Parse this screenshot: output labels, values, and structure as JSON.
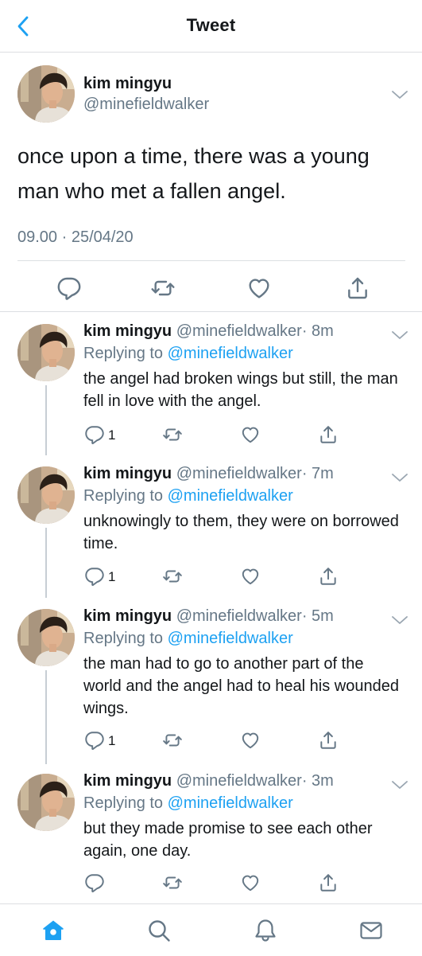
{
  "header": {
    "title": "Tweet",
    "back_icon": "chevron-left-icon"
  },
  "colors": {
    "accent": "#1da1f2",
    "muted": "#657786",
    "text": "#14171a",
    "divider": "#dcdfe2"
  },
  "main_tweet": {
    "name": "kim mingyu",
    "handle": "@minefieldwalker",
    "text": "once upon a time, there was a young man who met a fallen angel.",
    "timestamp": "09.00 · 25/04/20",
    "actions": [
      "reply-icon",
      "retweet-icon",
      "like-icon",
      "share-icon"
    ]
  },
  "replies": [
    {
      "name": "kim mingyu",
      "handle": "@minefieldwalker",
      "time": "· 8m",
      "replying_prefix": "Replying to ",
      "replying_to": "@minefieldwalker",
      "text": "the angel had broken wings but still, the man fell in love with the angel.",
      "reply_count": "1"
    },
    {
      "name": "kim mingyu",
      "handle": "@minefieldwalker",
      "time": "· 7m",
      "replying_prefix": "Replying to ",
      "replying_to": "@minefieldwalker",
      "text": "unknowingly to them, they were on borrowed time.",
      "reply_count": "1"
    },
    {
      "name": "kim mingyu",
      "handle": "@minefieldwalker",
      "time": "· 5m",
      "replying_prefix": "Replying to ",
      "replying_to": "@minefieldwalker",
      "text": "the man had to go to another part of the world and the angel had to heal his wounded wings.",
      "reply_count": "1"
    },
    {
      "name": "kim mingyu",
      "handle": "@minefieldwalker",
      "time": "· 3m",
      "replying_prefix": "Replying to ",
      "replying_to": "@minefieldwalker",
      "text": "but they made promise to see each other again, one day.",
      "reply_count": ""
    }
  ],
  "bottom_nav": [
    "home-icon",
    "search-icon",
    "notifications-icon",
    "messages-icon"
  ]
}
